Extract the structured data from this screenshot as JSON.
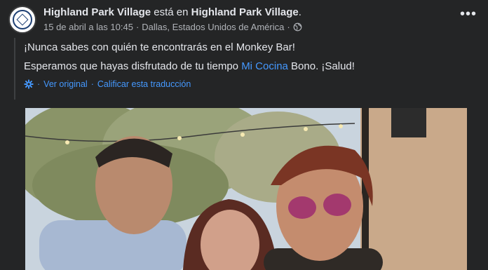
{
  "post": {
    "page_name": "Highland Park Village",
    "action_text": "está en",
    "location_name": "Highland Park Village",
    "period": ".",
    "timestamp": "15 de abril a las 10:45",
    "separator": "·",
    "place": "Dallas, Estados Unidos de América",
    "separator2": "·",
    "audience_icon": "globe-icon",
    "more_icon": "more-options-icon",
    "more_glyph": "•••",
    "text_line1": "¡Nunca sabes con quién te encontrarás en el Monkey Bar!",
    "text_line2_before": "Esperamos que hayas disfrutado de tu tiempo ",
    "text_line2_link": "Mi Cocina",
    "text_line2_after": " Bono. ¡Salud!",
    "see_original": "Ver original",
    "dot": "·",
    "rate_translation": "Calificar esta traducción",
    "photo_description": "Three people posing outdoors"
  },
  "colors": {
    "background": "#18191a",
    "card": "#242526",
    "link": "#4599ff",
    "secondary_text": "#b0b3b8",
    "primary_text": "#e4e6eb"
  }
}
